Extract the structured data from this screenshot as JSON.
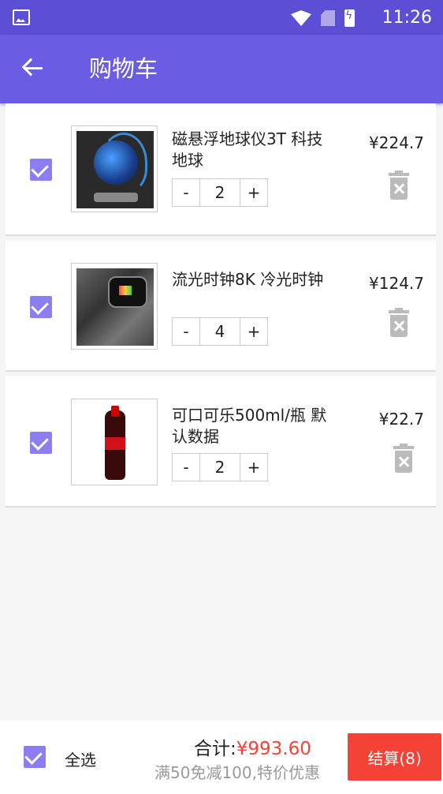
{
  "status_bar": {
    "time": "11:26"
  },
  "toolbar": {
    "title": "购物车"
  },
  "cart_items": [
    {
      "name": "磁悬浮地球仪3T 科技地球",
      "quantity": "2",
      "price": "¥224.7",
      "image": "levitating-globe"
    },
    {
      "name": "流光时钟8K 冷光时钟",
      "quantity": "4",
      "price": "¥124.7",
      "image": "smart-watch-band"
    },
    {
      "name": "可口可乐500ml/瓶 默认数据",
      "quantity": "2",
      "price": "¥22.7",
      "image": "coca-cola-bottle"
    }
  ],
  "stepper": {
    "minus": "-",
    "plus": "+"
  },
  "footer": {
    "select_all_label": "全选",
    "total_label": "合计:",
    "total_amount": "¥993.60",
    "promo": "满50免减100,特价优惠",
    "checkout_label": "结算(8)"
  },
  "colors": {
    "primary": "#6a5de4",
    "accent": "#8a7ef0",
    "price_red": "#f44336"
  }
}
